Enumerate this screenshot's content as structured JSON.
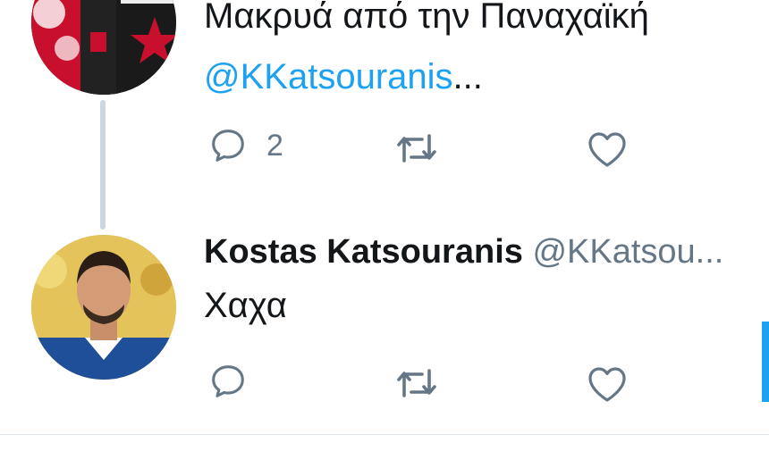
{
  "tweet1": {
    "text_line1": "Μακρυά από την Παναχαϊκή",
    "mention": "@KKatsouranis",
    "ellipsis": "...",
    "reply_count": "2"
  },
  "tweet2": {
    "name": "Kostas Katsouranis",
    "handle": "@KKatsou...",
    "text": "Χαχα"
  },
  "icons": {
    "reply": "reply-icon",
    "retweet": "retweet-icon",
    "like": "like-icon"
  },
  "colors": {
    "accent": "#1da1f2",
    "secondary_text": "#657786",
    "thread_line": "#ccd6dd"
  }
}
